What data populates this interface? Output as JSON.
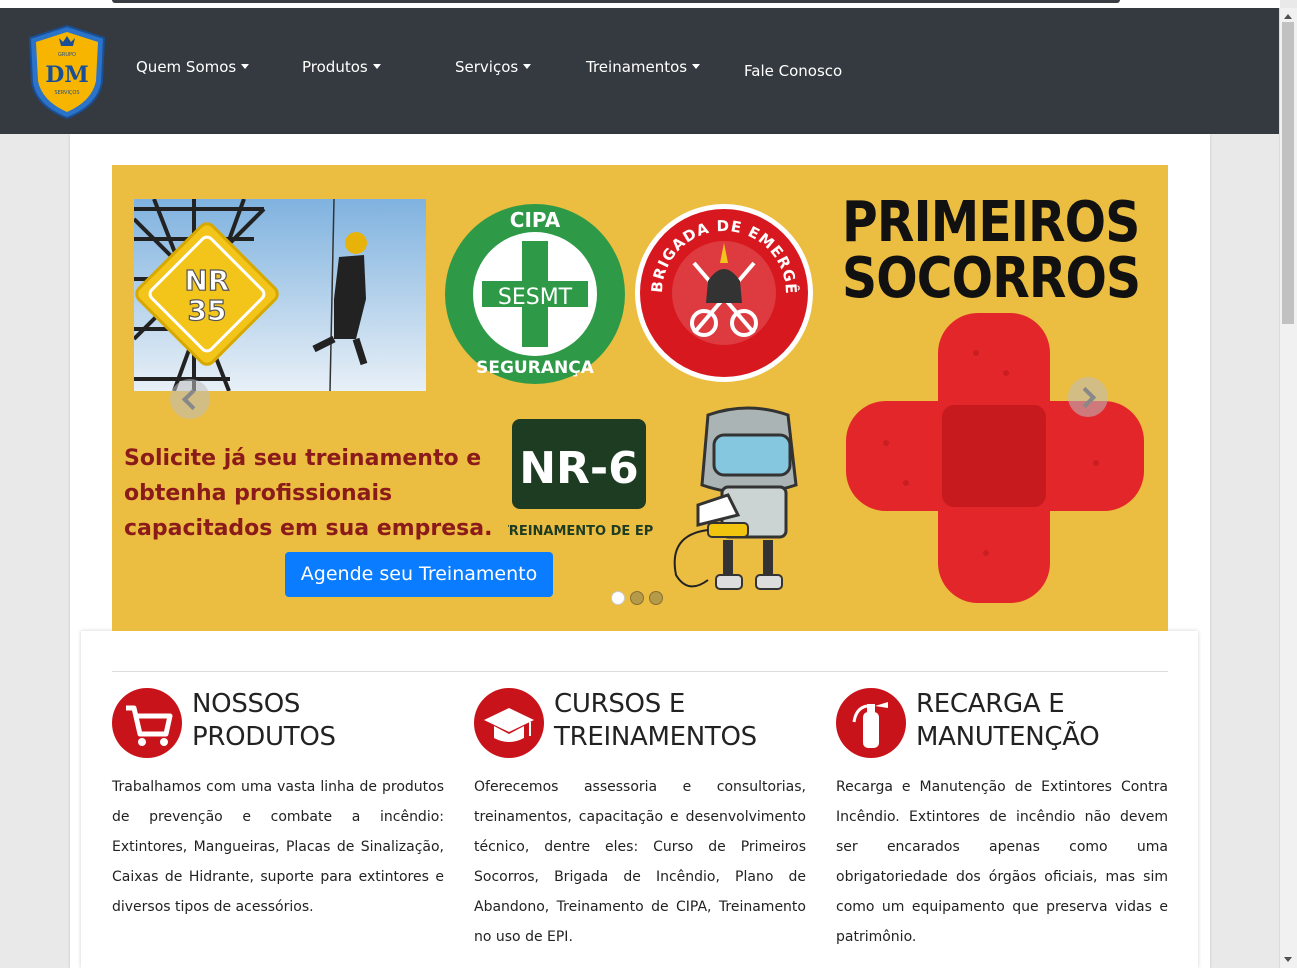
{
  "nav": {
    "logo": {
      "top_text": "GRUPO",
      "main_text": "DM",
      "bottom_text": "SERVIÇOS"
    },
    "items": [
      {
        "label": "Quem Somos",
        "dropdown": true
      },
      {
        "label": "Produtos",
        "dropdown": true
      },
      {
        "label": "Serviços",
        "dropdown": true
      },
      {
        "label": "Treinamentos",
        "dropdown": true
      },
      {
        "label": "Fale Conosco",
        "dropdown": false
      }
    ]
  },
  "hero": {
    "background": "#ebbd40",
    "nr35": {
      "line1": "NR",
      "line2": "35"
    },
    "cipa": {
      "top": "CIPA",
      "center": "SESMT",
      "bottom": "SEGURANÇA"
    },
    "brigada": {
      "text": "BRIGADA DE EMERGÊNCIA"
    },
    "primeiros": {
      "line1": "PRIMEIROS",
      "line2": "SOCORROS"
    },
    "nr6": {
      "title": "NR-6",
      "subtitle": "TREINAMENTO DE EPI"
    },
    "cta_text": "Solicite já seu treinamento e obtenha profissionais capacitados em sua empresa.",
    "cta_button": "Agende seu Treinamento",
    "slide_count": 3,
    "active_slide": 1
  },
  "features": [
    {
      "icon": "cart-icon",
      "title": "NOSSOS PRODUTOS",
      "text": "Trabalhamos com uma vasta linha de produtos de prevenção e combate a incêndio: Extintores, Mangueiras, Placas de Sinalização, Caixas de Hidrante, suporte para extintores e diversos tipos de acessórios."
    },
    {
      "icon": "graduation-cap-icon",
      "title": "CURSOS E TREINAMENTOS",
      "text": "Oferecemos assessoria e consultorias, treinamentos, capacitação e desenvolvimento técnico, dentre eles: Curso de Primeiros Socorros, Brigada de Incêndio, Plano de Abandono, Treinamento de CIPA, Treinamento no uso de EPI."
    },
    {
      "icon": "fire-extinguisher-icon",
      "title": "RECARGA E MANUTENÇÃO",
      "text": "Recarga e Manutenção de Extintores Contra Incêndio. Extintores de incêndio não devem ser encarados apenas como uma obrigatoriedade dos órgãos oficiais, mas sim como um equipamento que preserva vidas e patrimônio."
    }
  ]
}
